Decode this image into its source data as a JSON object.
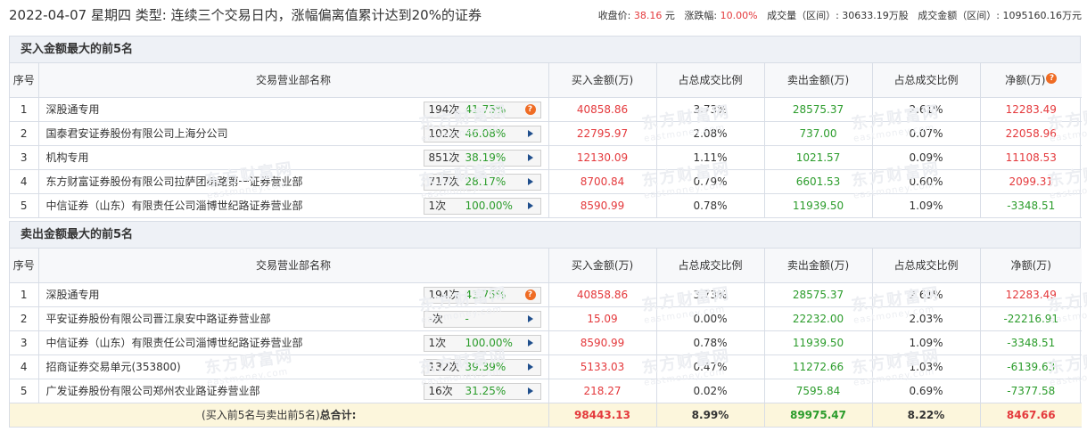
{
  "header": {
    "date": "2022-04-07",
    "weekday": "星期四",
    "type_label": "类型:",
    "type_value": "连续三个交易日内，涨幅偏离值累计达到20%的证券",
    "close_label": "收盘价:",
    "close_value": "38.16",
    "close_unit": "元",
    "change_label": "涨跌幅:",
    "change_value": "10.00%",
    "volume_label": "成交量（区间）:",
    "volume_value": "30633.19万股",
    "amount_label": "成交金额（区间）:",
    "amount_value": "1095160.16万元"
  },
  "columns": {
    "idx": "序号",
    "name": "交易营业部名称",
    "buy": "买入金额(万)",
    "buy_ratio": "占总成交比例",
    "sell": "卖出金额(万)",
    "sell_ratio": "占总成交比例",
    "net": "净额(万)"
  },
  "buy_section": {
    "title": "买入金额最大的前5名",
    "rows": [
      {
        "idx": "1",
        "name": "深股通专用",
        "count": "194次",
        "pct": "41.75%",
        "icon": "question-icon",
        "buy": "40858.86",
        "buy_ratio": "3.73%",
        "sell": "28575.37",
        "sell_ratio": "2.61%",
        "net": "12283.49",
        "net_sign": "pos"
      },
      {
        "idx": "2",
        "name": "国泰君安证券股份有限公司上海分公司",
        "count": "102次",
        "pct": "46.08%",
        "icon": "arrow-icon",
        "buy": "22795.97",
        "buy_ratio": "2.08%",
        "sell": "737.00",
        "sell_ratio": "0.07%",
        "net": "22058.96",
        "net_sign": "pos"
      },
      {
        "idx": "3",
        "name": "机构专用",
        "count": "851次",
        "pct": "38.19%",
        "icon": "arrow-icon",
        "buy": "12130.09",
        "buy_ratio": "1.11%",
        "sell": "1021.57",
        "sell_ratio": "0.09%",
        "net": "11108.53",
        "net_sign": "pos"
      },
      {
        "idx": "4",
        "name": "东方财富证券股份有限公司拉萨团结路第一证券营业部",
        "count": "717次",
        "pct": "28.17%",
        "icon": "arrow-icon",
        "buy": "8700.84",
        "buy_ratio": "0.79%",
        "sell": "6601.53",
        "sell_ratio": "0.60%",
        "net": "2099.31",
        "net_sign": "pos"
      },
      {
        "idx": "5",
        "name": "中信证券（山东）有限责任公司淄博世纪路证券营业部",
        "count": "1次",
        "pct": "100.00%",
        "icon": "arrow-icon",
        "buy": "8590.99",
        "buy_ratio": "0.78%",
        "sell": "11939.50",
        "sell_ratio": "1.09%",
        "net": "-3348.51",
        "net_sign": "neg"
      }
    ]
  },
  "sell_section": {
    "title": "卖出金额最大的前5名",
    "rows": [
      {
        "idx": "1",
        "name": "深股通专用",
        "count": "194次",
        "pct": "41.75%",
        "icon": "question-icon",
        "buy": "40858.86",
        "buy_ratio": "3.73%",
        "sell": "28575.37",
        "sell_ratio": "2.61%",
        "net": "12283.49",
        "net_sign": "pos"
      },
      {
        "idx": "2",
        "name": "平安证券股份有限公司晋江泉安中路证券营业部",
        "count": "-次",
        "pct": "-",
        "icon": "arrow-icon",
        "buy": "15.09",
        "buy_ratio": "0.00%",
        "sell": "22232.00",
        "sell_ratio": "2.03%",
        "net": "-22216.91",
        "net_sign": "neg"
      },
      {
        "idx": "3",
        "name": "中信证券（山东）有限责任公司淄博世纪路证券营业部",
        "count": "1次",
        "pct": "100.00%",
        "icon": "arrow-icon",
        "buy": "8590.99",
        "buy_ratio": "0.78%",
        "sell": "11939.50",
        "sell_ratio": "1.09%",
        "net": "-3348.51",
        "net_sign": "neg"
      },
      {
        "idx": "4",
        "name": "招商证券交易单元(353800)",
        "count": "132次",
        "pct": "39.39%",
        "icon": "arrow-icon",
        "buy": "5133.03",
        "buy_ratio": "0.47%",
        "sell": "11272.66",
        "sell_ratio": "1.03%",
        "net": "-6139.63",
        "net_sign": "neg"
      },
      {
        "idx": "5",
        "name": "广发证券股份有限公司郑州农业路证券营业部",
        "count": "16次",
        "pct": "31.25%",
        "icon": "arrow-icon",
        "buy": "218.27",
        "buy_ratio": "0.02%",
        "sell": "7595.84",
        "sell_ratio": "0.69%",
        "net": "-7377.58",
        "net_sign": "neg"
      }
    ],
    "total": {
      "label_prefix": "(买入前5名与卖出前5名)",
      "label_bold": "总合计:",
      "buy": "98443.13",
      "buy_ratio": "8.99%",
      "sell": "89975.47",
      "sell_ratio": "8.22%",
      "net": "8467.66"
    }
  },
  "watermark": {
    "cn": "东方财富网",
    "en": "eastmoney.com"
  },
  "colors": {
    "up": "#e4393c",
    "down": "#2b9c2b",
    "header_bg": "#eef1f6",
    "total_bg": "#fcf6dc",
    "icon_orange": "#ef6c24",
    "arrow_blue": "#1f4e8c"
  }
}
